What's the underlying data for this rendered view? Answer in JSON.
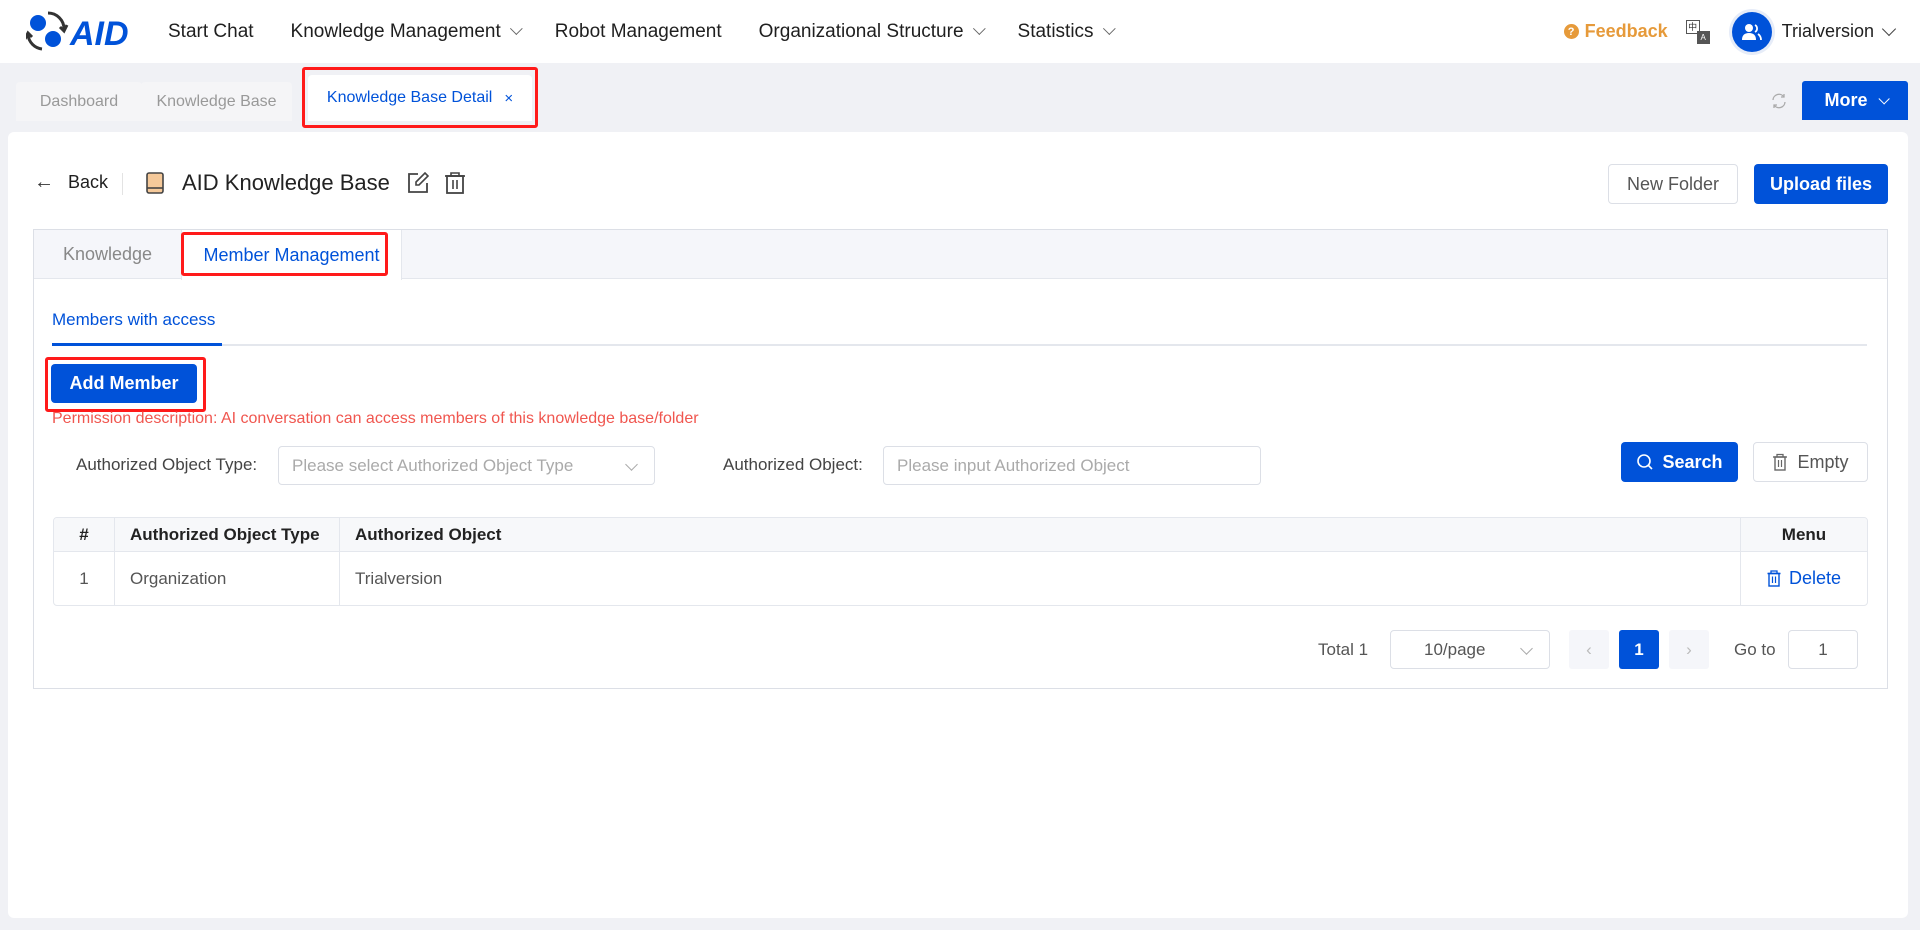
{
  "header": {
    "logo_text": "AID",
    "nav": [
      {
        "label": "Start Chat",
        "has_dropdown": false
      },
      {
        "label": "Knowledge Management",
        "has_dropdown": true
      },
      {
        "label": "Robot Management",
        "has_dropdown": false
      },
      {
        "label": "Organizational Structure",
        "has_dropdown": true
      },
      {
        "label": "Statistics",
        "has_dropdown": true
      }
    ],
    "feedback_label": "Feedback",
    "lang_icon": {
      "top": "中",
      "bottom": "A"
    },
    "user_name": "Trialversion"
  },
  "page_tabs": {
    "items": [
      {
        "label": "Dashboard",
        "active": false
      },
      {
        "label": "Knowledge Base",
        "active": false
      },
      {
        "label": "Knowledge Base Detail",
        "active": true,
        "closable": true
      }
    ],
    "close_glyph": "×",
    "more_label": "More"
  },
  "detail": {
    "back_label": "Back",
    "back_glyph": "←",
    "title": "AID Knowledge Base",
    "new_folder_label": "New Folder",
    "upload_label": "Upload files",
    "tabs": [
      {
        "label": "Knowledge",
        "active": false
      },
      {
        "label": "Member Management",
        "active": true
      }
    ]
  },
  "members": {
    "section_tab": "Members with access",
    "add_member_label": "Add Member",
    "permission_description": "Permission description: AI conversation can access members of this knowledge base/folder",
    "filters": {
      "type_label": "Authorized Object Type:",
      "type_placeholder": "Please select Authorized Object Type",
      "object_label": "Authorized Object:",
      "object_placeholder": "Please input Authorized Object",
      "object_value": ""
    },
    "search_label": "Search",
    "empty_label": "Empty",
    "table": {
      "columns": [
        "#",
        "Authorized Object Type",
        "Authorized Object",
        "Menu"
      ],
      "rows": [
        {
          "index": "1",
          "type": "Organization",
          "object": "Trialversion",
          "action": "Delete"
        }
      ]
    },
    "pagination": {
      "total_label": "Total 1",
      "page_size": "10/page",
      "prev_glyph": "‹",
      "next_glyph": "›",
      "current_page": "1",
      "goto_label": "Go to",
      "goto_value": "1"
    }
  },
  "colors": {
    "primary": "#0052d9",
    "feedback": "#e69a3a",
    "warning_text": "#f0564f",
    "highlight_box": "#ff1a1a"
  }
}
